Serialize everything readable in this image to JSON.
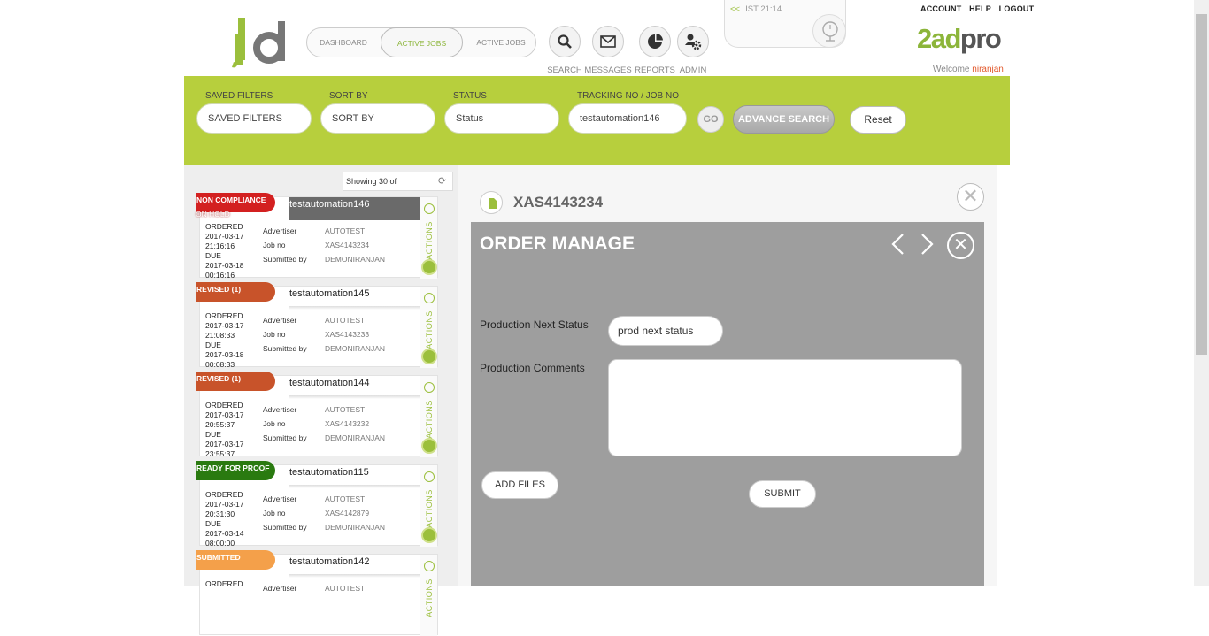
{
  "header": {
    "logo_text": "jd",
    "nav_tabs": [
      {
        "label": "DASHBOARD",
        "active": false
      },
      {
        "label": "ACTIVE JOBS",
        "active": true
      },
      {
        "label": "ACTIVE JOBS",
        "active": false
      }
    ],
    "icon_nav": [
      {
        "label": "SEARCH",
        "icon": "search-icon"
      },
      {
        "label": "MESSAGES",
        "icon": "envelope-icon"
      },
      {
        "label": "REPORTS",
        "icon": "pie-chart-icon"
      },
      {
        "label": "ADMIN",
        "icon": "users-gear-icon"
      }
    ],
    "clock": {
      "arrows": "<<",
      "text": "IST 21:14"
    },
    "top_links": [
      "ACCOUNT",
      "HELP",
      "LOGOUT"
    ],
    "brand": {
      "part1": "2ad",
      "part2": "pro"
    },
    "welcome": {
      "label": "Welcome",
      "user": "niranjan"
    }
  },
  "filters": {
    "saved_filters": {
      "label": "SAVED FILTERS",
      "value": "SAVED FILTERS"
    },
    "sort_by": {
      "label": "SORT BY",
      "value": "SORT BY"
    },
    "status": {
      "label": "STATUS",
      "value": "Status"
    },
    "tracking": {
      "label": "TRACKING NO / JOB NO",
      "value": "testautomation146"
    },
    "go_label": "GO",
    "advance_label": "ADVANCE SEARCH",
    "reset_label": "Reset"
  },
  "list": {
    "showing": "Showing 30 of",
    "cards": [
      {
        "badge": "NON COMPLIANCE",
        "sub": "ON HOLD",
        "title": "testautomation146",
        "ordered_label": "ORDERED",
        "ordered": "2017-03-17 21:16:16",
        "due_label": "DUE",
        "due": "2017-03-18 00:16:16",
        "advertiser_label": "Advertiser",
        "advertiser": "AUTOTEST",
        "jobno_label": "Job no",
        "jobno": "XAS4143234",
        "submitted_label": "Submitted by",
        "submitted": "DEMONIRANJAN",
        "actions": "ACTIONS"
      },
      {
        "badge": "REVISED (1)",
        "sub": "",
        "title": "testautomation145",
        "ordered_label": "ORDERED",
        "ordered": "2017-03-17 21:08:33",
        "due_label": "DUE",
        "due": "2017-03-18 00:08:33",
        "advertiser_label": "Advertiser",
        "advertiser": "AUTOTEST",
        "jobno_label": "Job no",
        "jobno": "XAS4143233",
        "submitted_label": "Submitted by",
        "submitted": "DEMONIRANJAN",
        "actions": "ACTIONS"
      },
      {
        "badge": "REVISED (1)",
        "sub": "",
        "title": "testautomation144",
        "ordered_label": "ORDERED",
        "ordered": "2017-03-17 20:55:37",
        "due_label": "DUE",
        "due": "2017-03-17 23:55:37",
        "advertiser_label": "Advertiser",
        "advertiser": "AUTOTEST",
        "jobno_label": "Job no",
        "jobno": "XAS4143232",
        "submitted_label": "Submitted by",
        "submitted": "DEMONIRANJAN",
        "actions": "ACTIONS"
      },
      {
        "badge": "READY FOR PROOF",
        "sub": "",
        "title": "testautomation115",
        "ordered_label": "ORDERED",
        "ordered": "2017-03-17 20:31:30",
        "due_label": "DUE",
        "due": "2017-03-14 08:00:00",
        "advertiser_label": "Advertiser",
        "advertiser": "AUTOTEST",
        "jobno_label": "Job no",
        "jobno": "XAS4142879",
        "submitted_label": "Submitted by",
        "submitted": "DEMONIRANJAN",
        "actions": "ACTIONS"
      },
      {
        "badge": "SUBMITTED",
        "sub": "",
        "title": "testautomation142",
        "ordered_label": "ORDERED",
        "ordered": "",
        "due_label": "",
        "due": "",
        "advertiser_label": "Advertiser",
        "advertiser": "AUTOTEST",
        "jobno_label": "",
        "jobno": "",
        "submitted_label": "",
        "submitted": "",
        "actions": "ACTIONS"
      }
    ]
  },
  "detail": {
    "job_id": "XAS4143234",
    "panel_title": "ORDER MANAGE",
    "prev": "<",
    "next": ">",
    "close": "✕",
    "next_status_label": "Production Next Status",
    "next_status_value": "prod next status",
    "comments_label": "Production Comments",
    "comments_value": "",
    "add_files_label": "ADD FILES",
    "submit_label": "SUBMIT"
  },
  "colors": {
    "accent_green": "#b7cf3d",
    "badge_red": "#d32020",
    "badge_orange": "#c8532a",
    "badge_green": "#2a7a10",
    "badge_light_orange": "#f4a04a",
    "panel_grey": "#9e9e9e"
  }
}
